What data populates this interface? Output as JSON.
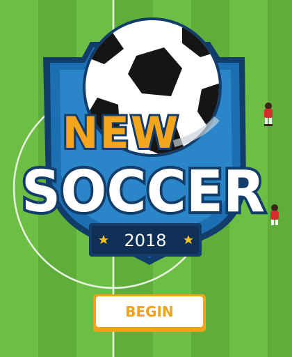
{
  "logo": {
    "word_top": "NEW",
    "word_main": "SOCCER",
    "year": "2018"
  },
  "menu": {
    "begin_label": "BEGIN"
  },
  "colors": {
    "grass_light": "#6cbe45",
    "grass_dark": "#5aa63a",
    "shield_blue": "#1d6fb3",
    "shield_dark": "#123d6b",
    "navy": "#0f2f57",
    "orange": "#f5a51c",
    "white": "#ffffff",
    "ball_black": "#151515",
    "player_red": "#d32d2d"
  }
}
